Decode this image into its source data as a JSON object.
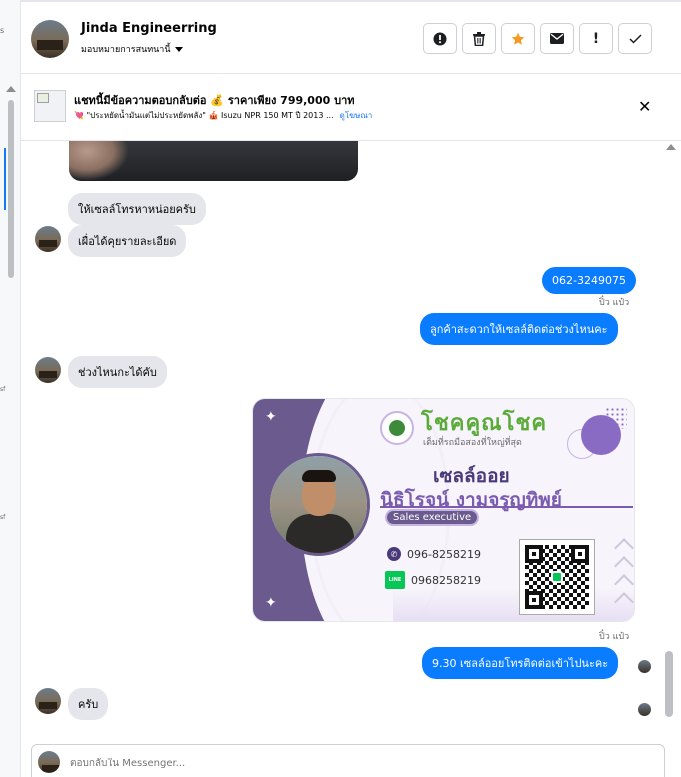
{
  "left_strip": {
    "fragments": [
      "s",
      "sf",
      "sf"
    ]
  },
  "header": {
    "contact_name": "Jinda Engineerring",
    "assign_label": "มอบหมายการสนทนานี้",
    "actions": [
      {
        "icon": "alert-circle-icon"
      },
      {
        "icon": "trash-icon"
      },
      {
        "icon": "star-icon",
        "color": "#f7971e"
      },
      {
        "icon": "envelope-icon"
      },
      {
        "icon": "exclamation-icon",
        "text": "!"
      },
      {
        "icon": "check-icon"
      }
    ]
  },
  "ad_bar": {
    "title": "แชทนี้มีข้อความตอบกลับต่อ 💰 ราคาเพียง 799,000 บาท",
    "subtitle": "💘 \"ประหยัดน้ำมันแต่ไม่ประหยัดพลัง\" 🎪 Isuzu NPR 150 MT ปี 2013 ...",
    "link": "ดูโฆษณา",
    "close": "✕"
  },
  "messages": [
    {
      "side": "in",
      "text": "ให้เซลล์โทรหาหน่อยครับ"
    },
    {
      "side": "in",
      "text": "เผื่อได้คุยรายละเอียด"
    },
    {
      "side": "out",
      "text": "062-3249075"
    },
    {
      "side": "out",
      "sender": "ปิ๋ว แป๋ว",
      "text": "ลูกค้าสะดวกให้เซลล์ติดต่อช่วงไหนคะ"
    },
    {
      "side": "in",
      "text": "ช่วงไหนกะได้คับ"
    },
    {
      "side": "out",
      "sender": "ปิ๋ว แป๋ว",
      "text": "9.30  เซลล์ออยโทรติดต่อเข้าไปนะคะ"
    },
    {
      "side": "in",
      "text": "ครับ"
    }
  ],
  "card": {
    "brand": "โชคคูณโชค",
    "brand_tag": "เต็มที่รถมือสองที่ใหญ่ที่สุด",
    "nickname": "เซลล์ออย",
    "fullname": "นิธิโรจน์  งามจรูญทิพย์",
    "role": "Sales executive",
    "phone": "096-8258219",
    "line_id": "0968258219",
    "line_label": "LINE"
  },
  "composer": {
    "placeholder": "ตอบกลับใน Messenger..."
  },
  "colors": {
    "outgoing_bubble": "#0a7cff",
    "incoming_bubble": "#e4e6eb",
    "card_purple": "#6a5a8e",
    "brand_green": "#5bab3a"
  }
}
